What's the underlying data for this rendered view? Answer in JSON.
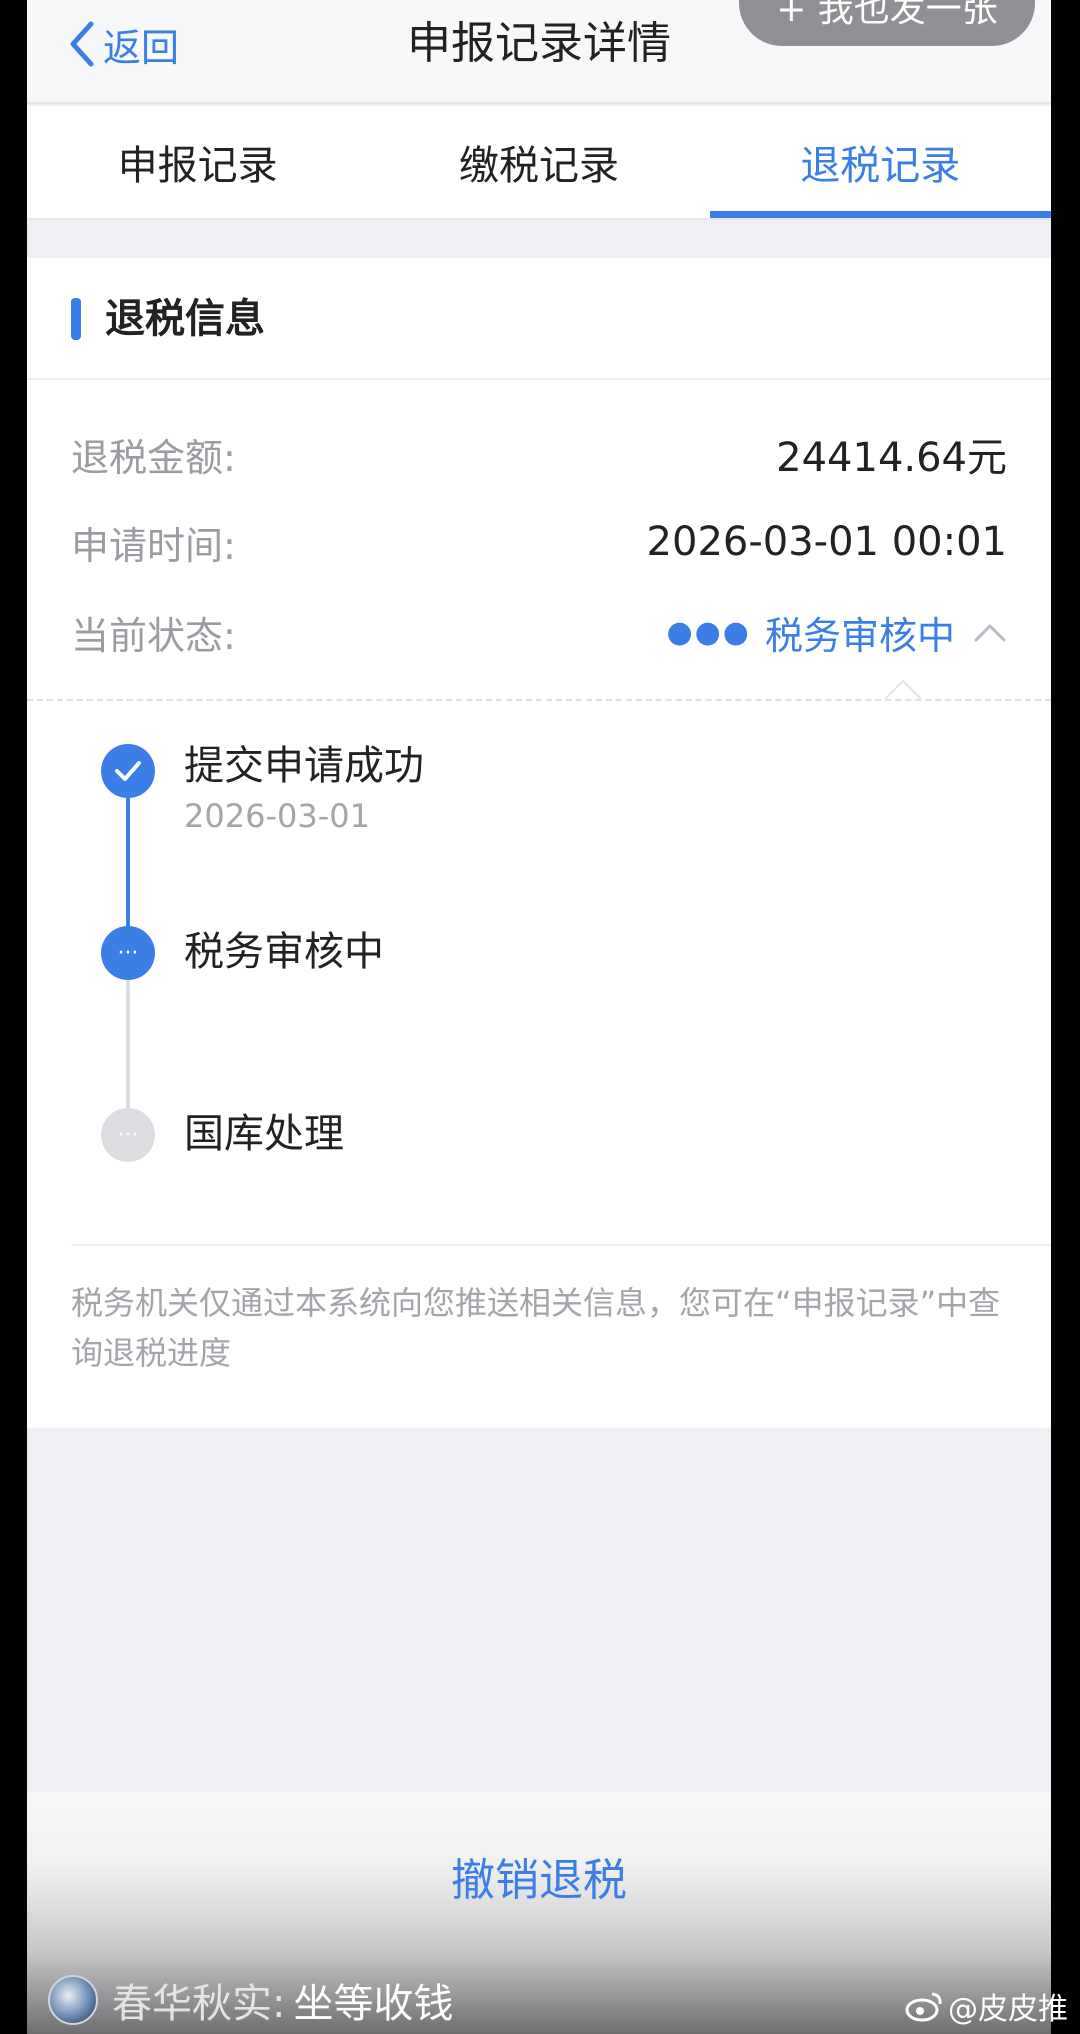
{
  "nav": {
    "back_label": "返回",
    "title": "申报记录详情",
    "share_label": "+ 我也发一张"
  },
  "tabs": [
    {
      "label": "申报记录",
      "active": false
    },
    {
      "label": "缴税记录",
      "active": false
    },
    {
      "label": "退税记录",
      "active": true
    }
  ],
  "refund": {
    "section_title": "退税信息",
    "amount_label": "退税金额:",
    "amount_value": "24414.64元",
    "time_label": "申请时间:",
    "time_value": "2026-03-01 00:01",
    "status_label": "当前状态:",
    "status_value": "税务审核中"
  },
  "timeline": [
    {
      "title": "提交申请成功",
      "date": "2026-03-01",
      "state": "done"
    },
    {
      "title": "税务审核中",
      "date": "",
      "state": "current"
    },
    {
      "title": "国库处理",
      "date": "",
      "state": "pending"
    }
  ],
  "note": "税务机关仅通过本系统向您推送相关信息，您可在“申报记录”中查询退税进度",
  "action": {
    "cancel_label": "撤销退税"
  },
  "overlay": {
    "username": "春华秋实:",
    "message": "坐等收钱",
    "watermark": "@皮皮推"
  },
  "colors": {
    "accent": "#3a7ee6",
    "pending": "#dcdde0"
  }
}
